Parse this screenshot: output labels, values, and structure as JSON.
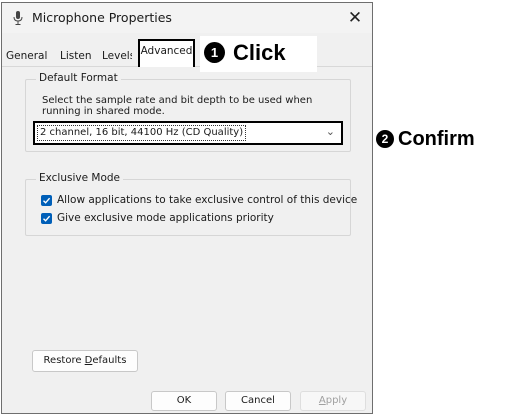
{
  "window": {
    "title": "Microphone Properties",
    "close_glyph": "✕"
  },
  "tabs": [
    {
      "label": "General",
      "active": false
    },
    {
      "label": "Listen",
      "active": false
    },
    {
      "label": "Levels",
      "active": false
    },
    {
      "label": "Advanced",
      "active": true
    }
  ],
  "default_format": {
    "legend": "Default Format",
    "description": "Select the sample rate and bit depth to be used when running in shared mode.",
    "selected_value": "2 channel, 16 bit, 44100 Hz (CD Quality)"
  },
  "exclusive_mode": {
    "legend": "Exclusive Mode",
    "options": [
      {
        "label": "Allow applications to take exclusive control of this device",
        "checked": true
      },
      {
        "label": "Give exclusive mode applications priority",
        "checked": true
      }
    ]
  },
  "buttons": {
    "restore_prefix": "Restore ",
    "restore_underlined": "D",
    "restore_suffix": "efaults",
    "ok": "OK",
    "cancel": "Cancel",
    "apply_underlined": "A",
    "apply_suffix": "pply"
  },
  "annotations": {
    "step1_number": "1",
    "step1_text": "Click",
    "step2_number": "2",
    "step2_text": "Confirm"
  },
  "colors": {
    "accent": "#005fb8",
    "dialog_bg": "#f0f0f0"
  }
}
